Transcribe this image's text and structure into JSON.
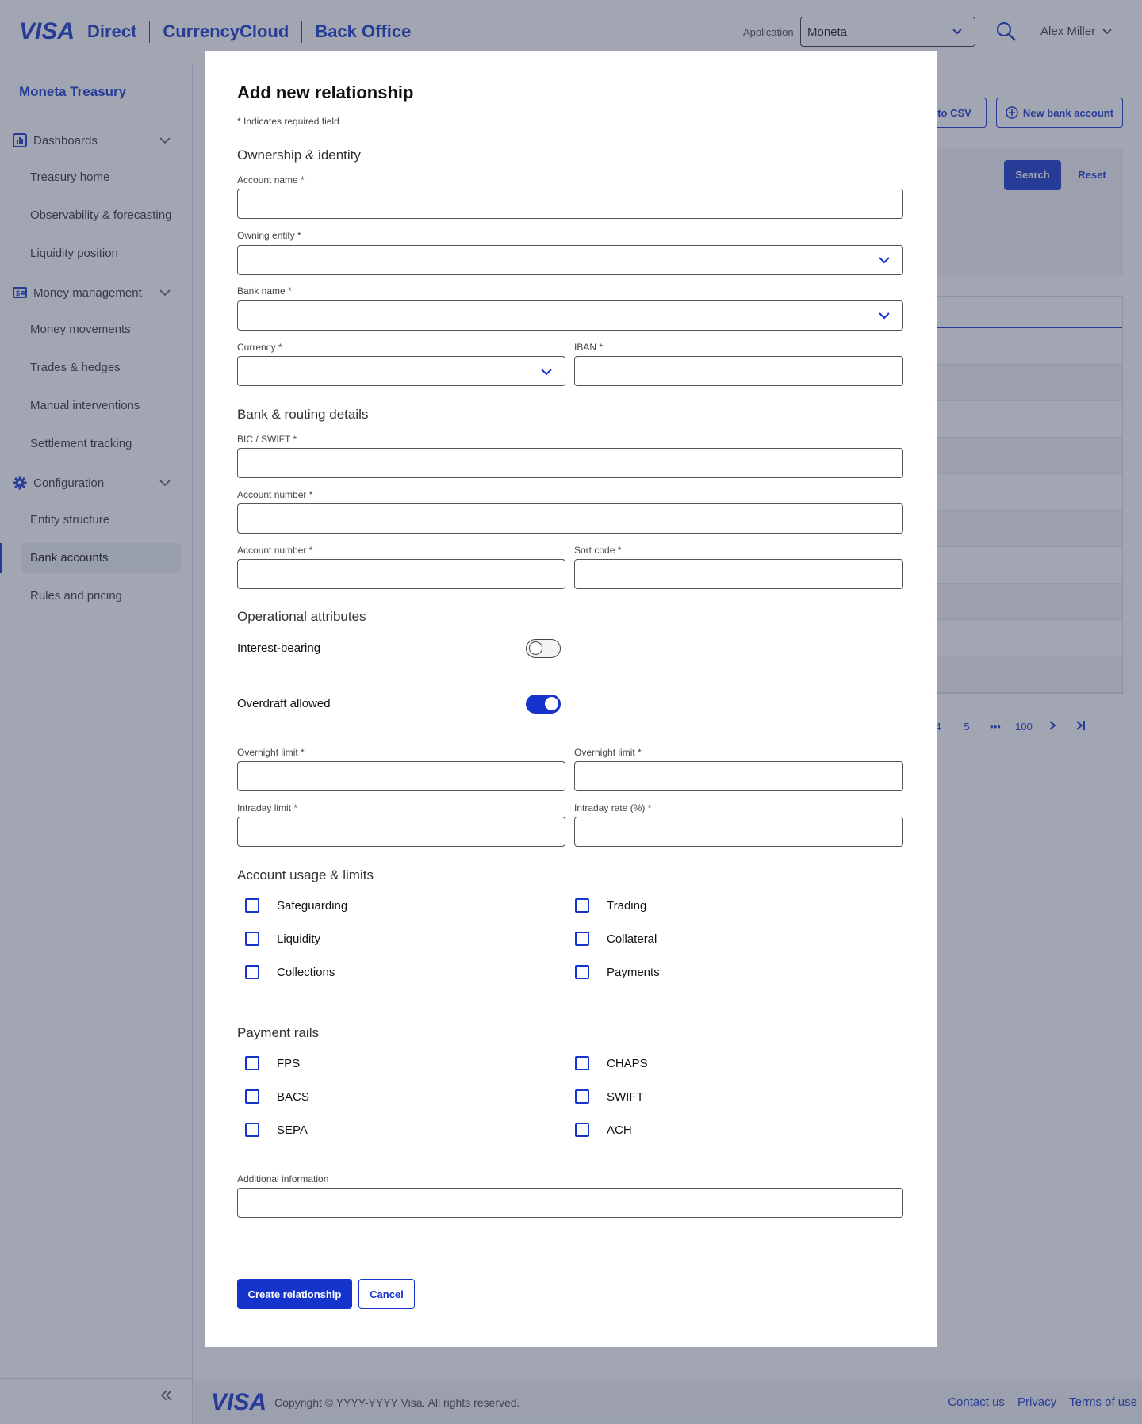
{
  "header": {
    "brand_visa": "VISA",
    "brand_direct": "Direct",
    "brand_currencycloud": "CurrencyCloud",
    "brand_backoffice": "Back Office",
    "application_label": "Application",
    "application_value": "Moneta",
    "user_name": "Alex Miller"
  },
  "sidebar": {
    "title": "Moneta Treasury",
    "groups": [
      {
        "label": "Dashboards",
        "icon": "chart-icon",
        "items": [
          "Treasury home",
          "Observability & forecasting",
          "Liquidity position"
        ]
      },
      {
        "label": "Money management",
        "icon": "money-icon",
        "items": [
          "Money movements",
          "Trades & hedges",
          "Manual interventions",
          "Settlement tracking"
        ]
      },
      {
        "label": "Configuration",
        "icon": "gear-icon",
        "items": [
          "Entity structure",
          "Bank accounts",
          "Rules and pricing"
        ]
      }
    ],
    "active_item": "Bank accounts"
  },
  "background": {
    "export_label": "rt to CSV",
    "new_bank_account_label": "New bank account",
    "search_label": "Search",
    "reset_label": "Reset",
    "pagination": [
      "4",
      "5",
      "•••",
      "100"
    ]
  },
  "modal": {
    "title": "Add new relationship",
    "required_note": "* Indicates required field",
    "sections": {
      "ownership": "Ownership & identity",
      "bank_routing": "Bank & routing details",
      "operational": "Operational attributes",
      "usage": "Account usage & limits",
      "rails": "Payment rails"
    },
    "fields": {
      "account_name": {
        "label": "Account name *",
        "value": ""
      },
      "owning_entity": {
        "label": "Owning entity *",
        "value": ""
      },
      "bank_name": {
        "label": "Bank name *",
        "value": ""
      },
      "currency": {
        "label": "Currency *",
        "value": ""
      },
      "iban": {
        "label": "IBAN *",
        "value": ""
      },
      "bic_swift": {
        "label": "BIC / SWIFT *",
        "value": ""
      },
      "account_number_1": {
        "label": "Account number *",
        "value": ""
      },
      "account_number_2": {
        "label": "Account number *",
        "value": ""
      },
      "sort_code": {
        "label": "Sort code *",
        "value": ""
      },
      "overnight_limit_1": {
        "label": "Overnight limit *",
        "value": ""
      },
      "overnight_limit_2": {
        "label": "Overnight limit *",
        "value": ""
      },
      "intraday_limit": {
        "label": "Intraday limit *",
        "value": ""
      },
      "intraday_rate": {
        "label": "Intraday rate (%) *",
        "value": ""
      },
      "additional_info": {
        "label": "Additional information",
        "value": ""
      }
    },
    "toggles": {
      "interest_bearing": {
        "label": "Interest-bearing",
        "on": false
      },
      "overdraft_allowed": {
        "label": "Overdraft allowed",
        "on": true
      }
    },
    "usage_checks": {
      "safeguarding": "Safeguarding",
      "trading": "Trading",
      "liquidity": "Liquidity",
      "collateral": "Collateral",
      "collections": "Collections",
      "payments": "Payments"
    },
    "rail_checks": {
      "fps": "FPS",
      "chaps": "CHAPS",
      "bacs": "BACS",
      "swift": "SWIFT",
      "sepa": "SEPA",
      "ach": "ACH"
    },
    "buttons": {
      "create": "Create relationship",
      "cancel": "Cancel"
    }
  },
  "footer": {
    "logo": "VISA",
    "copyright": "Copyright © YYYY-YYYY Visa. All rights reserved.",
    "links": [
      "Contact us",
      "Privacy",
      "Terms of use"
    ]
  },
  "colors": {
    "brand_blue": "#1434cb",
    "overlay": "rgba(60,70,95,0.48)"
  }
}
